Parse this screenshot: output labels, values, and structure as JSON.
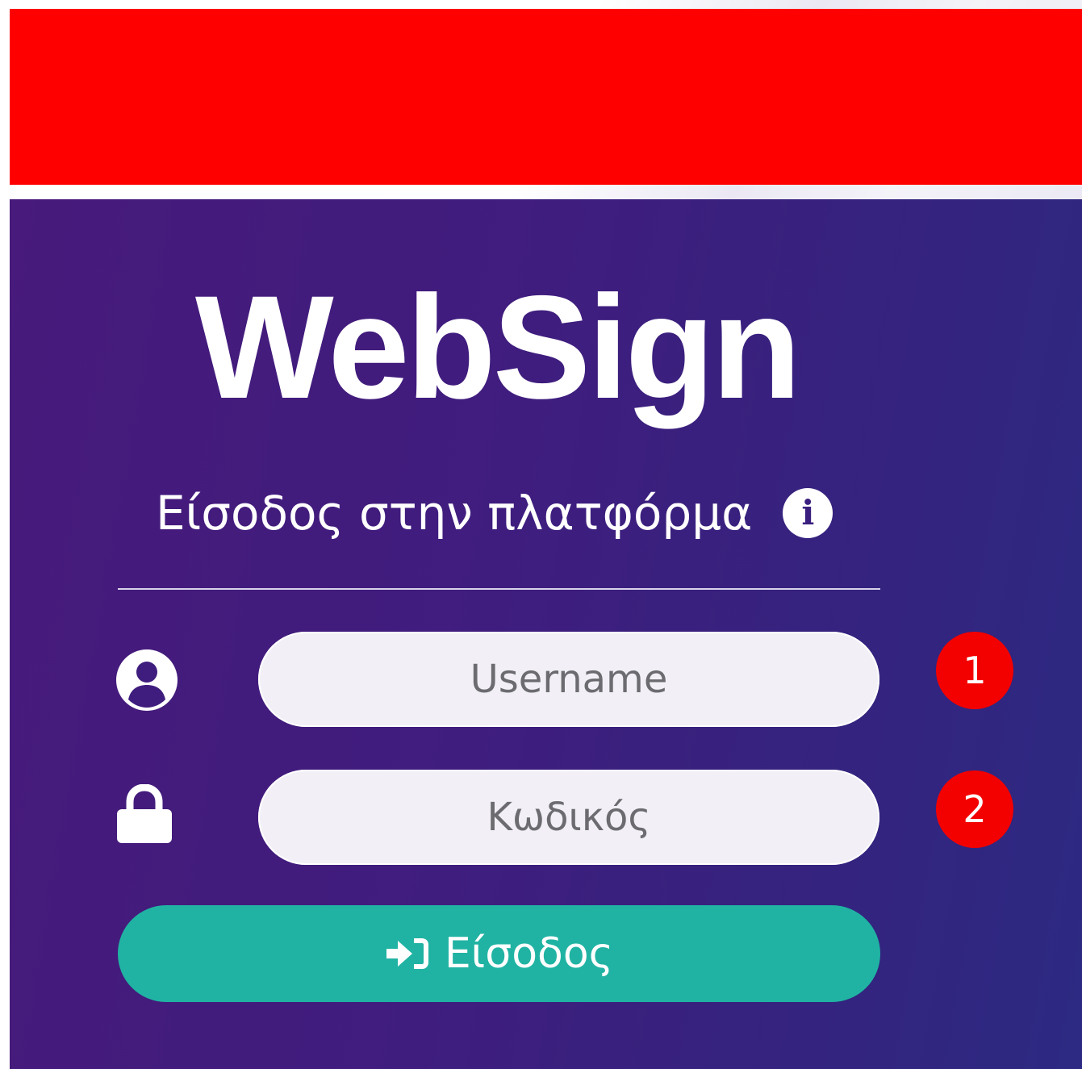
{
  "colors": {
    "banner": "#fe0000",
    "panel_gradient_start": "#471a7b",
    "panel_gradient_end": "#2c2a82",
    "button": "#20b3a3",
    "badge": "#f30000",
    "input_background": "#f2f0f6"
  },
  "header": {
    "logo_text": "WebSign",
    "subtitle": "Είσοδος στην πλατφόρμα",
    "info_icon": "info-icon"
  },
  "form": {
    "username": {
      "placeholder": "Username",
      "value": "",
      "icon": "user-icon",
      "badge": "1"
    },
    "password": {
      "placeholder": "Κωδικός",
      "value": "",
      "icon": "lock-icon",
      "badge": "2"
    },
    "submit": {
      "label": "Είσοδος",
      "icon": "sign-in-icon"
    }
  }
}
